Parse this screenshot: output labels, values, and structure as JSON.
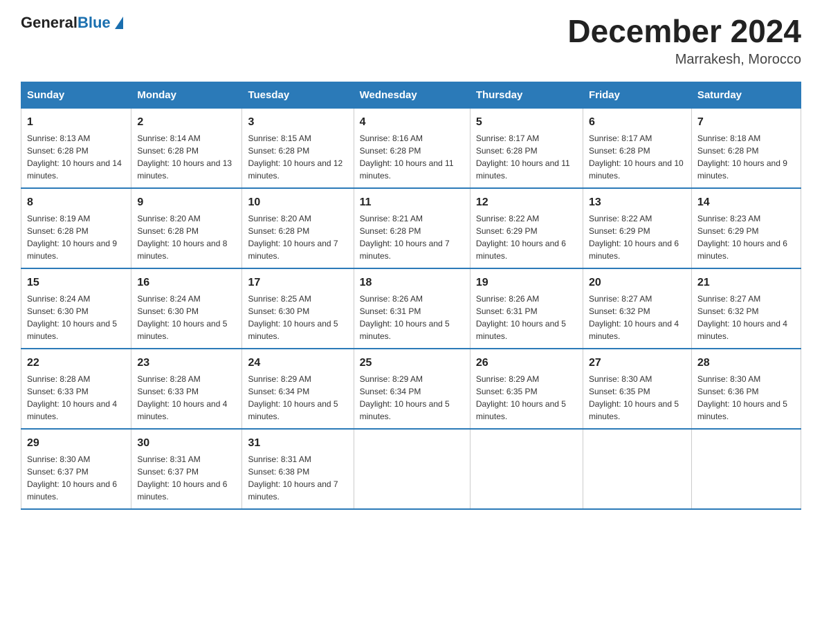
{
  "header": {
    "logo_general": "General",
    "logo_blue": "Blue",
    "month_title": "December 2024",
    "location": "Marrakesh, Morocco"
  },
  "days_of_week": [
    "Sunday",
    "Monday",
    "Tuesday",
    "Wednesday",
    "Thursday",
    "Friday",
    "Saturday"
  ],
  "weeks": [
    [
      {
        "day": "1",
        "sunrise": "Sunrise: 8:13 AM",
        "sunset": "Sunset: 6:28 PM",
        "daylight": "Daylight: 10 hours and 14 minutes."
      },
      {
        "day": "2",
        "sunrise": "Sunrise: 8:14 AM",
        "sunset": "Sunset: 6:28 PM",
        "daylight": "Daylight: 10 hours and 13 minutes."
      },
      {
        "day": "3",
        "sunrise": "Sunrise: 8:15 AM",
        "sunset": "Sunset: 6:28 PM",
        "daylight": "Daylight: 10 hours and 12 minutes."
      },
      {
        "day": "4",
        "sunrise": "Sunrise: 8:16 AM",
        "sunset": "Sunset: 6:28 PM",
        "daylight": "Daylight: 10 hours and 11 minutes."
      },
      {
        "day": "5",
        "sunrise": "Sunrise: 8:17 AM",
        "sunset": "Sunset: 6:28 PM",
        "daylight": "Daylight: 10 hours and 11 minutes."
      },
      {
        "day": "6",
        "sunrise": "Sunrise: 8:17 AM",
        "sunset": "Sunset: 6:28 PM",
        "daylight": "Daylight: 10 hours and 10 minutes."
      },
      {
        "day": "7",
        "sunrise": "Sunrise: 8:18 AM",
        "sunset": "Sunset: 6:28 PM",
        "daylight": "Daylight: 10 hours and 9 minutes."
      }
    ],
    [
      {
        "day": "8",
        "sunrise": "Sunrise: 8:19 AM",
        "sunset": "Sunset: 6:28 PM",
        "daylight": "Daylight: 10 hours and 9 minutes."
      },
      {
        "day": "9",
        "sunrise": "Sunrise: 8:20 AM",
        "sunset": "Sunset: 6:28 PM",
        "daylight": "Daylight: 10 hours and 8 minutes."
      },
      {
        "day": "10",
        "sunrise": "Sunrise: 8:20 AM",
        "sunset": "Sunset: 6:28 PM",
        "daylight": "Daylight: 10 hours and 7 minutes."
      },
      {
        "day": "11",
        "sunrise": "Sunrise: 8:21 AM",
        "sunset": "Sunset: 6:28 PM",
        "daylight": "Daylight: 10 hours and 7 minutes."
      },
      {
        "day": "12",
        "sunrise": "Sunrise: 8:22 AM",
        "sunset": "Sunset: 6:29 PM",
        "daylight": "Daylight: 10 hours and 6 minutes."
      },
      {
        "day": "13",
        "sunrise": "Sunrise: 8:22 AM",
        "sunset": "Sunset: 6:29 PM",
        "daylight": "Daylight: 10 hours and 6 minutes."
      },
      {
        "day": "14",
        "sunrise": "Sunrise: 8:23 AM",
        "sunset": "Sunset: 6:29 PM",
        "daylight": "Daylight: 10 hours and 6 minutes."
      }
    ],
    [
      {
        "day": "15",
        "sunrise": "Sunrise: 8:24 AM",
        "sunset": "Sunset: 6:30 PM",
        "daylight": "Daylight: 10 hours and 5 minutes."
      },
      {
        "day": "16",
        "sunrise": "Sunrise: 8:24 AM",
        "sunset": "Sunset: 6:30 PM",
        "daylight": "Daylight: 10 hours and 5 minutes."
      },
      {
        "day": "17",
        "sunrise": "Sunrise: 8:25 AM",
        "sunset": "Sunset: 6:30 PM",
        "daylight": "Daylight: 10 hours and 5 minutes."
      },
      {
        "day": "18",
        "sunrise": "Sunrise: 8:26 AM",
        "sunset": "Sunset: 6:31 PM",
        "daylight": "Daylight: 10 hours and 5 minutes."
      },
      {
        "day": "19",
        "sunrise": "Sunrise: 8:26 AM",
        "sunset": "Sunset: 6:31 PM",
        "daylight": "Daylight: 10 hours and 5 minutes."
      },
      {
        "day": "20",
        "sunrise": "Sunrise: 8:27 AM",
        "sunset": "Sunset: 6:32 PM",
        "daylight": "Daylight: 10 hours and 4 minutes."
      },
      {
        "day": "21",
        "sunrise": "Sunrise: 8:27 AM",
        "sunset": "Sunset: 6:32 PM",
        "daylight": "Daylight: 10 hours and 4 minutes."
      }
    ],
    [
      {
        "day": "22",
        "sunrise": "Sunrise: 8:28 AM",
        "sunset": "Sunset: 6:33 PM",
        "daylight": "Daylight: 10 hours and 4 minutes."
      },
      {
        "day": "23",
        "sunrise": "Sunrise: 8:28 AM",
        "sunset": "Sunset: 6:33 PM",
        "daylight": "Daylight: 10 hours and 4 minutes."
      },
      {
        "day": "24",
        "sunrise": "Sunrise: 8:29 AM",
        "sunset": "Sunset: 6:34 PM",
        "daylight": "Daylight: 10 hours and 5 minutes."
      },
      {
        "day": "25",
        "sunrise": "Sunrise: 8:29 AM",
        "sunset": "Sunset: 6:34 PM",
        "daylight": "Daylight: 10 hours and 5 minutes."
      },
      {
        "day": "26",
        "sunrise": "Sunrise: 8:29 AM",
        "sunset": "Sunset: 6:35 PM",
        "daylight": "Daylight: 10 hours and 5 minutes."
      },
      {
        "day": "27",
        "sunrise": "Sunrise: 8:30 AM",
        "sunset": "Sunset: 6:35 PM",
        "daylight": "Daylight: 10 hours and 5 minutes."
      },
      {
        "day": "28",
        "sunrise": "Sunrise: 8:30 AM",
        "sunset": "Sunset: 6:36 PM",
        "daylight": "Daylight: 10 hours and 5 minutes."
      }
    ],
    [
      {
        "day": "29",
        "sunrise": "Sunrise: 8:30 AM",
        "sunset": "Sunset: 6:37 PM",
        "daylight": "Daylight: 10 hours and 6 minutes."
      },
      {
        "day": "30",
        "sunrise": "Sunrise: 8:31 AM",
        "sunset": "Sunset: 6:37 PM",
        "daylight": "Daylight: 10 hours and 6 minutes."
      },
      {
        "day": "31",
        "sunrise": "Sunrise: 8:31 AM",
        "sunset": "Sunset: 6:38 PM",
        "daylight": "Daylight: 10 hours and 7 minutes."
      },
      {
        "day": "",
        "sunrise": "",
        "sunset": "",
        "daylight": ""
      },
      {
        "day": "",
        "sunrise": "",
        "sunset": "",
        "daylight": ""
      },
      {
        "day": "",
        "sunrise": "",
        "sunset": "",
        "daylight": ""
      },
      {
        "day": "",
        "sunrise": "",
        "sunset": "",
        "daylight": ""
      }
    ]
  ]
}
